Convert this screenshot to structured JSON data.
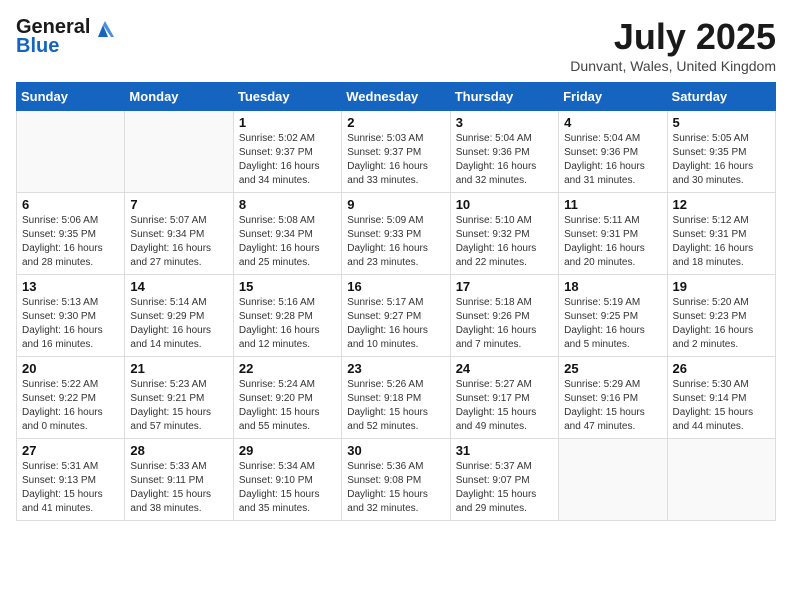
{
  "logo": {
    "general": "General",
    "blue": "Blue"
  },
  "title": "July 2025",
  "location": "Dunvant, Wales, United Kingdom",
  "headers": [
    "Sunday",
    "Monday",
    "Tuesday",
    "Wednesday",
    "Thursday",
    "Friday",
    "Saturday"
  ],
  "weeks": [
    [
      {
        "day": "",
        "info": ""
      },
      {
        "day": "",
        "info": ""
      },
      {
        "day": "1",
        "info": "Sunrise: 5:02 AM\nSunset: 9:37 PM\nDaylight: 16 hours\nand 34 minutes."
      },
      {
        "day": "2",
        "info": "Sunrise: 5:03 AM\nSunset: 9:37 PM\nDaylight: 16 hours\nand 33 minutes."
      },
      {
        "day": "3",
        "info": "Sunrise: 5:04 AM\nSunset: 9:36 PM\nDaylight: 16 hours\nand 32 minutes."
      },
      {
        "day": "4",
        "info": "Sunrise: 5:04 AM\nSunset: 9:36 PM\nDaylight: 16 hours\nand 31 minutes."
      },
      {
        "day": "5",
        "info": "Sunrise: 5:05 AM\nSunset: 9:35 PM\nDaylight: 16 hours\nand 30 minutes."
      }
    ],
    [
      {
        "day": "6",
        "info": "Sunrise: 5:06 AM\nSunset: 9:35 PM\nDaylight: 16 hours\nand 28 minutes."
      },
      {
        "day": "7",
        "info": "Sunrise: 5:07 AM\nSunset: 9:34 PM\nDaylight: 16 hours\nand 27 minutes."
      },
      {
        "day": "8",
        "info": "Sunrise: 5:08 AM\nSunset: 9:34 PM\nDaylight: 16 hours\nand 25 minutes."
      },
      {
        "day": "9",
        "info": "Sunrise: 5:09 AM\nSunset: 9:33 PM\nDaylight: 16 hours\nand 23 minutes."
      },
      {
        "day": "10",
        "info": "Sunrise: 5:10 AM\nSunset: 9:32 PM\nDaylight: 16 hours\nand 22 minutes."
      },
      {
        "day": "11",
        "info": "Sunrise: 5:11 AM\nSunset: 9:31 PM\nDaylight: 16 hours\nand 20 minutes."
      },
      {
        "day": "12",
        "info": "Sunrise: 5:12 AM\nSunset: 9:31 PM\nDaylight: 16 hours\nand 18 minutes."
      }
    ],
    [
      {
        "day": "13",
        "info": "Sunrise: 5:13 AM\nSunset: 9:30 PM\nDaylight: 16 hours\nand 16 minutes."
      },
      {
        "day": "14",
        "info": "Sunrise: 5:14 AM\nSunset: 9:29 PM\nDaylight: 16 hours\nand 14 minutes."
      },
      {
        "day": "15",
        "info": "Sunrise: 5:16 AM\nSunset: 9:28 PM\nDaylight: 16 hours\nand 12 minutes."
      },
      {
        "day": "16",
        "info": "Sunrise: 5:17 AM\nSunset: 9:27 PM\nDaylight: 16 hours\nand 10 minutes."
      },
      {
        "day": "17",
        "info": "Sunrise: 5:18 AM\nSunset: 9:26 PM\nDaylight: 16 hours\nand 7 minutes."
      },
      {
        "day": "18",
        "info": "Sunrise: 5:19 AM\nSunset: 9:25 PM\nDaylight: 16 hours\nand 5 minutes."
      },
      {
        "day": "19",
        "info": "Sunrise: 5:20 AM\nSunset: 9:23 PM\nDaylight: 16 hours\nand 2 minutes."
      }
    ],
    [
      {
        "day": "20",
        "info": "Sunrise: 5:22 AM\nSunset: 9:22 PM\nDaylight: 16 hours\nand 0 minutes."
      },
      {
        "day": "21",
        "info": "Sunrise: 5:23 AM\nSunset: 9:21 PM\nDaylight: 15 hours\nand 57 minutes."
      },
      {
        "day": "22",
        "info": "Sunrise: 5:24 AM\nSunset: 9:20 PM\nDaylight: 15 hours\nand 55 minutes."
      },
      {
        "day": "23",
        "info": "Sunrise: 5:26 AM\nSunset: 9:18 PM\nDaylight: 15 hours\nand 52 minutes."
      },
      {
        "day": "24",
        "info": "Sunrise: 5:27 AM\nSunset: 9:17 PM\nDaylight: 15 hours\nand 49 minutes."
      },
      {
        "day": "25",
        "info": "Sunrise: 5:29 AM\nSunset: 9:16 PM\nDaylight: 15 hours\nand 47 minutes."
      },
      {
        "day": "26",
        "info": "Sunrise: 5:30 AM\nSunset: 9:14 PM\nDaylight: 15 hours\nand 44 minutes."
      }
    ],
    [
      {
        "day": "27",
        "info": "Sunrise: 5:31 AM\nSunset: 9:13 PM\nDaylight: 15 hours\nand 41 minutes."
      },
      {
        "day": "28",
        "info": "Sunrise: 5:33 AM\nSunset: 9:11 PM\nDaylight: 15 hours\nand 38 minutes."
      },
      {
        "day": "29",
        "info": "Sunrise: 5:34 AM\nSunset: 9:10 PM\nDaylight: 15 hours\nand 35 minutes."
      },
      {
        "day": "30",
        "info": "Sunrise: 5:36 AM\nSunset: 9:08 PM\nDaylight: 15 hours\nand 32 minutes."
      },
      {
        "day": "31",
        "info": "Sunrise: 5:37 AM\nSunset: 9:07 PM\nDaylight: 15 hours\nand 29 minutes."
      },
      {
        "day": "",
        "info": ""
      },
      {
        "day": "",
        "info": ""
      }
    ]
  ]
}
